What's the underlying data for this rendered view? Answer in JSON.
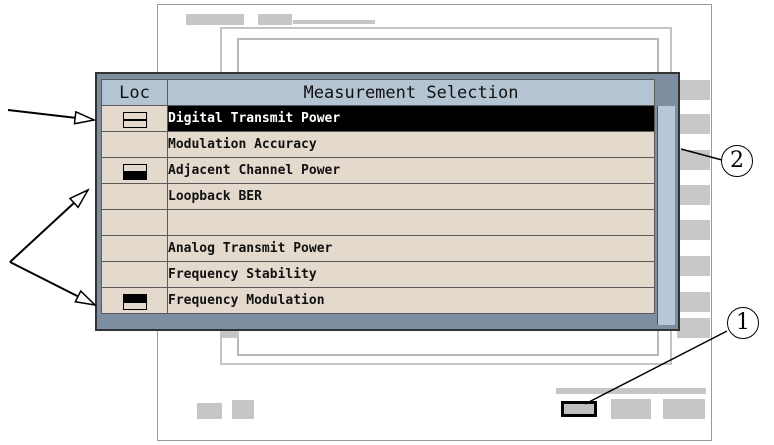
{
  "menu": {
    "header": {
      "loc": "Loc",
      "title": "Measurement Selection"
    },
    "rows": [
      {
        "label": "Digital Transmit Power",
        "selected": true,
        "loc_icon": "top-open-bottom-open"
      },
      {
        "label": "Modulation Accuracy",
        "selected": false,
        "loc_icon": ""
      },
      {
        "label": "Adjacent Channel Power",
        "selected": false,
        "loc_icon": "top-open-bottom-filled"
      },
      {
        "label": "Loopback BER",
        "selected": false,
        "loc_icon": ""
      },
      {
        "label": "",
        "selected": false,
        "loc_icon": ""
      },
      {
        "label": "Analog Transmit Power",
        "selected": false,
        "loc_icon": ""
      },
      {
        "label": "Frequency Stability",
        "selected": false,
        "loc_icon": ""
      },
      {
        "label": "Frequency Modulation",
        "selected": false,
        "loc_icon": "top-filled-bottom-open"
      }
    ]
  },
  "callouts": {
    "one": "1",
    "two": "2"
  },
  "colors": {
    "menu_frame": "#7d8ea1",
    "row_bg": "#e3d9cc",
    "header_bg": "#b5c4d3",
    "selected_bg": "#000000"
  }
}
